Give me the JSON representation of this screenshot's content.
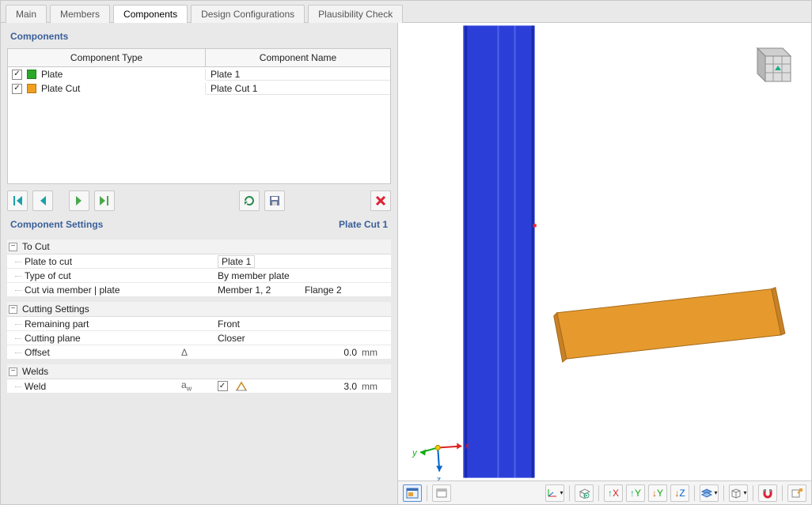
{
  "tabs": [
    "Main",
    "Members",
    "Components",
    "Design Configurations",
    "Plausibility Check"
  ],
  "active_tab": 2,
  "components_panel": {
    "title": "Components",
    "headers": {
      "type": "Component Type",
      "name": "Component Name"
    },
    "rows": [
      {
        "checked": true,
        "color": "#2aa82a",
        "type": "Plate",
        "name": "Plate 1"
      },
      {
        "checked": true,
        "color": "#f0a020",
        "type": "Plate Cut",
        "name": "Plate Cut 1"
      }
    ]
  },
  "settings_panel": {
    "title": "Component Settings",
    "context": "Plate Cut 1",
    "groups": [
      {
        "title": "To Cut",
        "rows": [
          {
            "label": "Plate to cut",
            "value": "Plate 1",
            "boxed": true
          },
          {
            "label": "Type of cut",
            "value": "By member plate"
          },
          {
            "label": "Cut via member | plate",
            "value": "Member 1, 2",
            "value2": "Flange 2"
          }
        ]
      },
      {
        "title": "Cutting Settings",
        "rows": [
          {
            "label": "Remaining part",
            "value": "Front"
          },
          {
            "label": "Cutting plane",
            "value": "Closer"
          },
          {
            "label": "Offset",
            "symbol": "Δ",
            "number": "0.0",
            "unit": "mm"
          }
        ]
      },
      {
        "title": "Welds",
        "rows": [
          {
            "label": "Weld",
            "symbol": "aw",
            "checkbox": true,
            "icon": "weld",
            "number": "3.0",
            "unit": "mm"
          }
        ]
      }
    ]
  },
  "colors": {
    "beam": "#2b3fd8",
    "plate": "#e69a2e"
  }
}
